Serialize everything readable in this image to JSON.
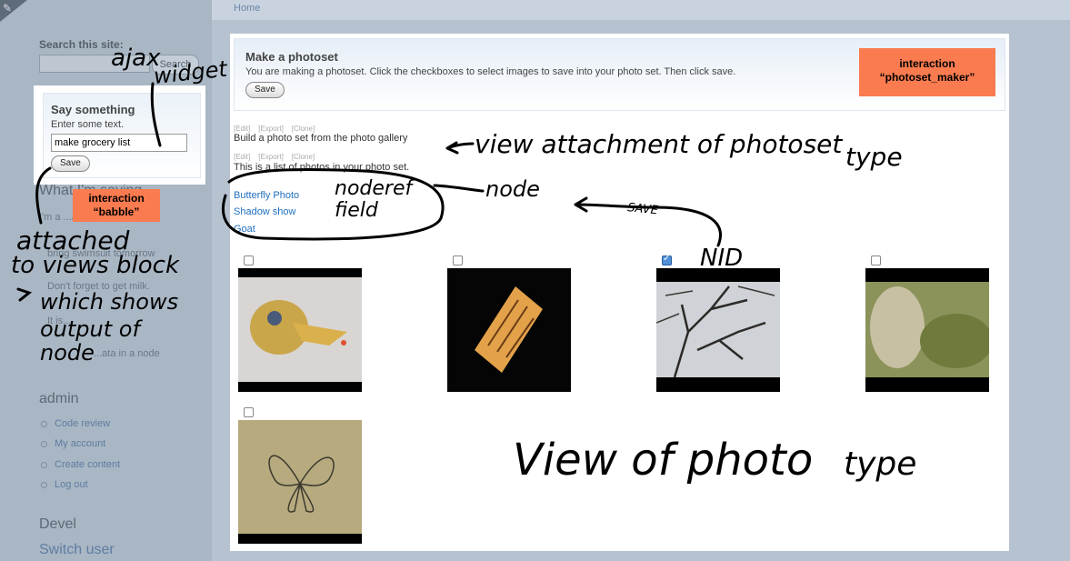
{
  "breadcrumb": "Home",
  "sidebar": {
    "search_label": "Search this site:",
    "search_button": "Search",
    "babble_block": {
      "title": "Say something",
      "hint": "Enter some text.",
      "input_value": "make grocery list",
      "save_label": "Save"
    },
    "babble_section_title": "What I'm saying",
    "babble_items": [
      "I'm a  ...ar.",
      "bring swimsuit tomorrow",
      "Don't forget to get milk.",
      "It is...",
      "...ata in a node"
    ],
    "admin_title": "admin",
    "admin_links": [
      "Code review",
      "My account",
      "Create content",
      "Log out"
    ],
    "devel_title": "Devel",
    "devel_link": "Switch user"
  },
  "photoset": {
    "title": "Make a photoset",
    "description": "You are making a photoset. Click the checkboxes to select images to save into your photo set. Then click save.",
    "save_label": "Save"
  },
  "attachment": {
    "admin_links": [
      "[Edit]",
      "[Export]",
      "[Clone]"
    ],
    "text": "Build a photo set from the photo gallery",
    "list_text": "This is a list of photos in your photo set.",
    "nodes": [
      "Butterfly Photo",
      "Shadow show",
      "Goat"
    ]
  },
  "photos": [
    {
      "name": "photo-yellow-creature",
      "checked": false
    },
    {
      "name": "photo-orange-card",
      "checked": false
    },
    {
      "name": "photo-bare-tree",
      "checked": true
    },
    {
      "name": "photo-green-blur",
      "checked": false
    },
    {
      "name": "photo-butterfly",
      "checked": false
    }
  ],
  "annotations": {
    "babble_tag_line1": "interaction",
    "babble_tag_line2": "“babble”",
    "maker_tag_line1": "interaction",
    "maker_tag_line2": "“photoset_maker”",
    "hand_ajax": "ajax",
    "hand_widget": "widget",
    "hand_attached1": "attached",
    "hand_attached2": "to views block",
    "hand_which1": "which shows",
    "hand_which2": "output of",
    "hand_which3": "node",
    "hand_view_attach1": "view attachment of photoset",
    "hand_view_attach2": "type",
    "hand_noderef1": "noderef",
    "hand_noderef2": "field",
    "hand_node": "node",
    "hand_save": "SAVE",
    "hand_nid": "NID",
    "hand_view_photo1": "View of photo",
    "hand_view_photo2": "type"
  },
  "colors": {
    "tag_orange": "#f97b4f",
    "link_blue": "#1f6fbf",
    "overlay_gray": "#aebac8"
  }
}
